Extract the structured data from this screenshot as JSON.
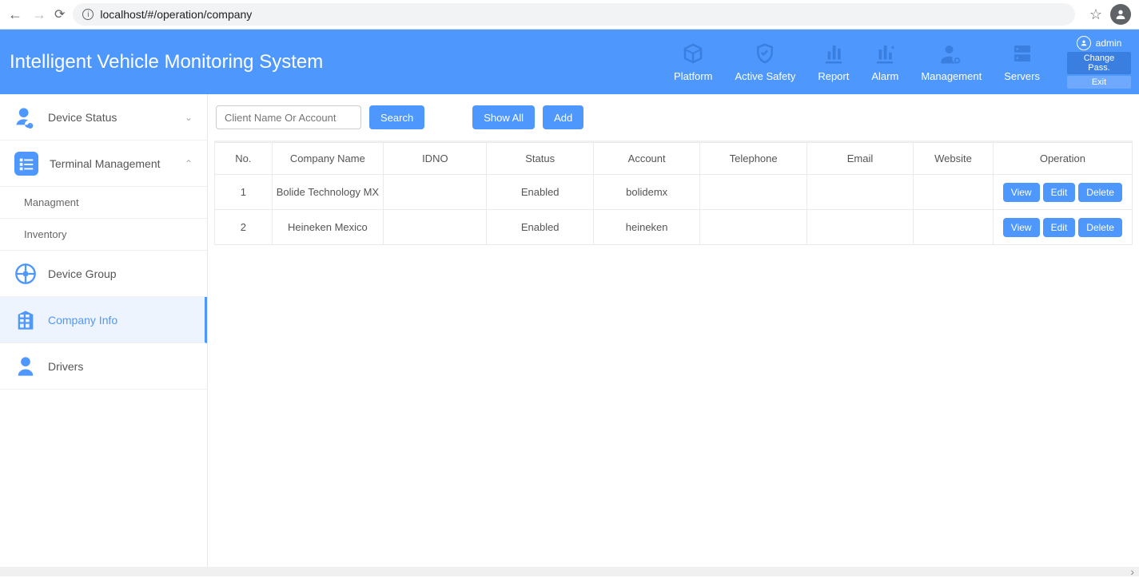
{
  "browser": {
    "url": "localhost/#/operation/company"
  },
  "header": {
    "title": "Intelligent Vehicle Monitoring System",
    "nav": {
      "platform": "Platform",
      "active_safety": "Active Safety",
      "report": "Report",
      "alarm": "Alarm",
      "management": "Management",
      "servers": "Servers"
    },
    "user": {
      "name": "admin",
      "change_pass": "Change Pass.",
      "exit": "Exit"
    }
  },
  "sidebar": {
    "device_status": "Device Status",
    "terminal_management": "Terminal Management",
    "managment": "Managment",
    "inventory": "Inventory",
    "device_group": "Device Group",
    "company_info": "Company Info",
    "drivers": "Drivers"
  },
  "toolbar": {
    "search_placeholder": "Client Name Or Account",
    "search": "Search",
    "show_all": "Show All",
    "add": "Add"
  },
  "table": {
    "headers": {
      "no": "No.",
      "company_name": "Company Name",
      "idno": "IDNO",
      "status": "Status",
      "account": "Account",
      "telephone": "Telephone",
      "email": "Email",
      "website": "Website",
      "operation": "Operation"
    },
    "rows": [
      {
        "no": "1",
        "company": "Bolide Technology MX",
        "idno": "",
        "status": "Enabled",
        "account": "bolidemx",
        "telephone": "",
        "email": "",
        "website": ""
      },
      {
        "no": "2",
        "company": "Heineken Mexico",
        "idno": "",
        "status": "Enabled",
        "account": "heineken",
        "telephone": "",
        "email": "",
        "website": ""
      }
    ],
    "ops": {
      "view": "View",
      "edit": "Edit",
      "delete": "Delete"
    }
  }
}
